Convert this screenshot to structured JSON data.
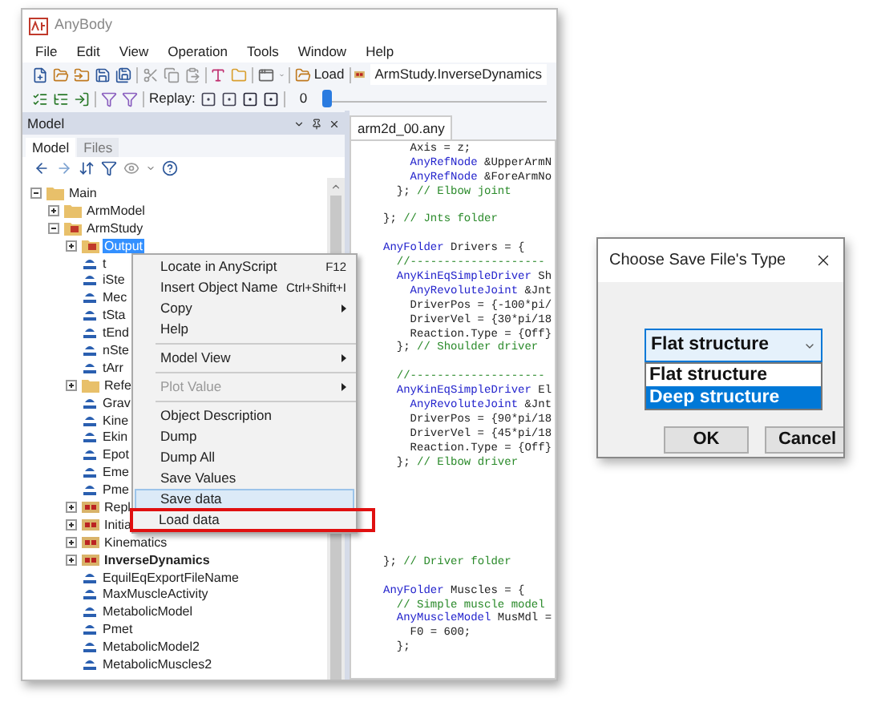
{
  "window": {
    "title": "AnyBody"
  },
  "menu": [
    "File",
    "Edit",
    "View",
    "Operation",
    "Tools",
    "Window",
    "Help"
  ],
  "toolbar": {
    "load_button": "Load",
    "study_field": "ArmStudy.InverseDynamics",
    "replay_label": "Replay:",
    "frame": "0",
    "level": 0.0
  },
  "model_panel": {
    "title": "Model",
    "tabs": [
      {
        "label": "Model",
        "selected": true
      },
      {
        "label": "Files",
        "selected": false
      }
    ],
    "tree": [
      {
        "label": "Main",
        "kind": "folder",
        "expanded": true,
        "selected": false,
        "active": false,
        "children": [
          {
            "label": "ArmModel",
            "kind": "folder",
            "expanded": false,
            "selected": false,
            "active": false
          },
          {
            "label": "ArmStudy",
            "kind": "study",
            "expanded": true,
            "selected": false,
            "active": false,
            "children": [
              {
                "label": "Output",
                "kind": "study",
                "expanded": false,
                "selected": true,
                "active": false
              },
              {
                "label": "t",
                "kind": "value",
                "selected": false,
                "active": false
              },
              {
                "label": "iSte",
                "kind": "value",
                "selected": false,
                "active": false
              },
              {
                "label": "Mec",
                "kind": "value",
                "selected": false,
                "active": false
              },
              {
                "label": "tSta",
                "kind": "value",
                "selected": false,
                "active": false
              },
              {
                "label": "tEnd",
                "kind": "value",
                "selected": false,
                "active": false
              },
              {
                "label": "nSte",
                "kind": "value",
                "selected": false,
                "active": false
              },
              {
                "label": "tArr",
                "kind": "value",
                "selected": false,
                "active": false
              },
              {
                "label": "Refe",
                "kind": "folder",
                "expanded": false,
                "selected": false,
                "active": false
              },
              {
                "label": "Grav",
                "kind": "value",
                "selected": false,
                "active": false
              },
              {
                "label": "Kine",
                "kind": "value",
                "selected": false,
                "active": false
              },
              {
                "label": "Ekin",
                "kind": "value",
                "selected": false,
                "active": false
              },
              {
                "label": "Epot",
                "kind": "value",
                "selected": false,
                "active": false
              },
              {
                "label": "Eme",
                "kind": "value",
                "selected": false,
                "active": false
              },
              {
                "label": "Pme",
                "kind": "value",
                "selected": false,
                "active": false
              },
              {
                "label": "Repl",
                "kind": "operation",
                "expanded": false,
                "selected": false,
                "active": false
              },
              {
                "label": "Initia",
                "kind": "operation",
                "expanded": false,
                "selected": false,
                "active": false
              },
              {
                "label": "Kinematics",
                "kind": "operation",
                "expanded": false,
                "selected": false,
                "active": false
              },
              {
                "label": "InverseDynamics",
                "kind": "operation",
                "expanded": false,
                "selected": false,
                "active": true
              },
              {
                "label": "EquilEqExportFileName",
                "kind": "value",
                "selected": false,
                "active": false
              },
              {
                "label": "MaxMuscleActivity",
                "kind": "value",
                "selected": false,
                "active": false
              },
              {
                "label": "MetabolicModel",
                "kind": "value",
                "selected": false,
                "active": false
              },
              {
                "label": "Pmet",
                "kind": "value",
                "selected": false,
                "active": false
              },
              {
                "label": "MetabolicModel2",
                "kind": "value",
                "selected": false,
                "active": false
              },
              {
                "label": "MetabolicMuscles2",
                "kind": "value",
                "selected": false,
                "active": false
              }
            ]
          }
        ]
      }
    ]
  },
  "editor": {
    "tabs": [
      {
        "label": "arm2d_00.any",
        "selected": true
      }
    ],
    "lines": [
      {
        "kind": "code",
        "tokens": [
          {
            "kind": "text",
            "text": "    Axis = z;"
          }
        ]
      },
      {
        "kind": "code",
        "tokens": [
          {
            "kind": "keyword",
            "text": "    AnyRefNode"
          },
          {
            "kind": "text",
            "text": " &UpperArmN"
          }
        ]
      },
      {
        "kind": "code",
        "tokens": [
          {
            "kind": "keyword",
            "text": "    AnyRefNode"
          },
          {
            "kind": "text",
            "text": " &ForeArmNo"
          }
        ]
      },
      {
        "kind": "code",
        "tokens": [
          {
            "kind": "text",
            "text": "  }; "
          },
          {
            "kind": "comment",
            "text": "// Elbow joint"
          }
        ]
      },
      {
        "kind": "blank"
      },
      {
        "kind": "code",
        "tokens": [
          {
            "kind": "text",
            "text": "}; "
          },
          {
            "kind": "comment",
            "text": "// Jnts folder"
          }
        ]
      },
      {
        "kind": "blank"
      },
      {
        "kind": "code",
        "tokens": [
          {
            "kind": "keyword",
            "text": "AnyFolder"
          },
          {
            "kind": "text",
            "text": " Drivers = {"
          }
        ]
      },
      {
        "kind": "code",
        "tokens": [
          {
            "kind": "comment",
            "text": "  //--------------------"
          }
        ]
      },
      {
        "kind": "code",
        "tokens": [
          {
            "kind": "keyword",
            "text": "  AnyKinEqSimpleDriver"
          },
          {
            "kind": "text",
            "text": " Sh"
          }
        ]
      },
      {
        "kind": "code",
        "tokens": [
          {
            "kind": "keyword",
            "text": "    AnyRevoluteJoint"
          },
          {
            "kind": "text",
            "text": " &Jnt"
          }
        ]
      },
      {
        "kind": "code",
        "tokens": [
          {
            "kind": "text",
            "text": "    DriverPos = {-100*pi/"
          }
        ]
      },
      {
        "kind": "code",
        "tokens": [
          {
            "kind": "text",
            "text": "    DriverVel = {30*pi/18"
          }
        ]
      },
      {
        "kind": "code",
        "tokens": [
          {
            "kind": "text",
            "text": "    Reaction.Type = {Off}"
          }
        ]
      },
      {
        "kind": "code",
        "tokens": [
          {
            "kind": "text",
            "text": "  }; "
          },
          {
            "kind": "comment",
            "text": "// Shoulder driver"
          }
        ]
      },
      {
        "kind": "blank"
      },
      {
        "kind": "code",
        "tokens": [
          {
            "kind": "comment",
            "text": "  //--------------------"
          }
        ]
      },
      {
        "kind": "code",
        "tokens": [
          {
            "kind": "keyword",
            "text": "  AnyKinEqSimpleDriver"
          },
          {
            "kind": "text",
            "text": " El"
          }
        ]
      },
      {
        "kind": "code",
        "tokens": [
          {
            "kind": "keyword",
            "text": "    AnyRevoluteJoint"
          },
          {
            "kind": "text",
            "text": " &Jnt"
          }
        ]
      },
      {
        "kind": "code",
        "tokens": [
          {
            "kind": "text",
            "text": "    DriverPos = {90*pi/18"
          }
        ]
      },
      {
        "kind": "code",
        "tokens": [
          {
            "kind": "text",
            "text": "    DriverVel = {45*pi/18"
          }
        ]
      },
      {
        "kind": "code",
        "tokens": [
          {
            "kind": "text",
            "text": "    Reaction.Type = {Off}"
          }
        ]
      },
      {
        "kind": "code",
        "tokens": [
          {
            "kind": "text",
            "text": "  }; "
          },
          {
            "kind": "comment",
            "text": "// Elbow driver"
          }
        ]
      },
      {
        "kind": "blank"
      },
      {
        "kind": "blank"
      },
      {
        "kind": "blank"
      },
      {
        "kind": "blank"
      },
      {
        "kind": "blank"
      },
      {
        "kind": "blank"
      },
      {
        "kind": "code",
        "tokens": [
          {
            "kind": "text",
            "text": "}; "
          },
          {
            "kind": "comment",
            "text": "// Driver folder"
          }
        ]
      },
      {
        "kind": "blank"
      },
      {
        "kind": "code",
        "tokens": [
          {
            "kind": "keyword",
            "text": "AnyFolder"
          },
          {
            "kind": "text",
            "text": " Muscles = {"
          }
        ]
      },
      {
        "kind": "code",
        "tokens": [
          {
            "kind": "comment",
            "text": "  // Simple muscle model"
          }
        ]
      },
      {
        "kind": "code",
        "tokens": [
          {
            "kind": "keyword",
            "text": "  AnyMuscleModel"
          },
          {
            "kind": "text",
            "text": " MusMdl ="
          }
        ]
      },
      {
        "kind": "code",
        "tokens": [
          {
            "kind": "text",
            "text": "    F0 = 600;"
          }
        ]
      },
      {
        "kind": "code",
        "tokens": [
          {
            "kind": "text",
            "text": "  };"
          }
        ]
      }
    ]
  },
  "context_menu": {
    "items": [
      {
        "kind": "item",
        "label": "Locate in AnyScript",
        "shortcut": "F12",
        "submenu": false,
        "disabled": false,
        "selected": false,
        "marked": false
      },
      {
        "kind": "item",
        "label": "Insert Object Name",
        "shortcut": "Ctrl+Shift+I",
        "submenu": false,
        "disabled": false,
        "selected": false,
        "marked": false
      },
      {
        "kind": "item",
        "label": "Copy",
        "submenu": true,
        "disabled": false,
        "selected": false,
        "marked": false
      },
      {
        "kind": "item",
        "label": "Help",
        "submenu": false,
        "disabled": false,
        "selected": false,
        "marked": false
      },
      {
        "kind": "separator"
      },
      {
        "kind": "item",
        "label": "Model View",
        "submenu": true,
        "disabled": false,
        "selected": false,
        "marked": false
      },
      {
        "kind": "separator"
      },
      {
        "kind": "item",
        "label": "Plot Value",
        "submenu": true,
        "disabled": true,
        "selected": false,
        "marked": false
      },
      {
        "kind": "separator"
      },
      {
        "kind": "item",
        "label": "Object Description",
        "submenu": false,
        "disabled": false,
        "selected": false,
        "marked": false
      },
      {
        "kind": "item",
        "label": "Dump",
        "submenu": false,
        "disabled": false,
        "selected": false,
        "marked": false
      },
      {
        "kind": "item",
        "label": "Dump All",
        "submenu": false,
        "disabled": false,
        "selected": false,
        "marked": false
      },
      {
        "kind": "item",
        "label": "Save Values",
        "submenu": false,
        "disabled": false,
        "selected": false,
        "marked": false
      },
      {
        "kind": "item",
        "label": "Save data",
        "submenu": false,
        "disabled": false,
        "selected": true,
        "marked": false
      },
      {
        "kind": "item",
        "label": "Load data",
        "submenu": false,
        "disabled": false,
        "selected": false,
        "marked": true
      }
    ]
  },
  "dialog": {
    "title": "Choose Save File's Type",
    "combo": {
      "value": "Flat structure",
      "expanded": true,
      "options": [
        {
          "label": "Flat structure",
          "highlighted": false
        },
        {
          "label": "Deep structure",
          "highlighted": true
        }
      ]
    },
    "buttons": [
      "OK",
      "Cancel"
    ]
  }
}
